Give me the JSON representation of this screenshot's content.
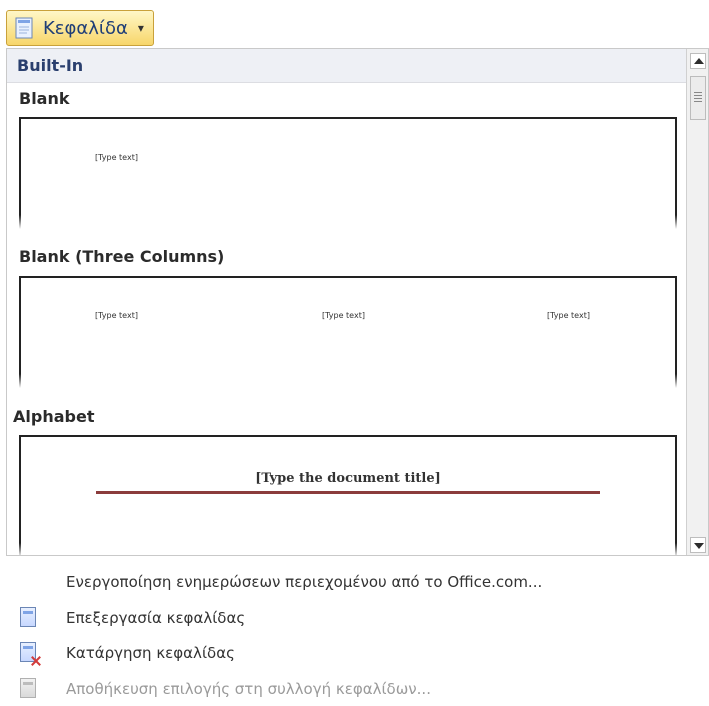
{
  "header": {
    "button_label": "Κεφαλίδα",
    "button_caret": "▾"
  },
  "gallery": {
    "builtin_label": "Built-In",
    "sections": {
      "blank": {
        "title": "Blank",
        "placeholder": "[Type text]"
      },
      "blank_three_columns": {
        "title": "Blank (Three Columns)",
        "placeholders": [
          "[Type text]",
          "[Type text]",
          "[Type text]"
        ]
      },
      "alphabet": {
        "title": "Alphabet",
        "document_title_placeholder": "[Type the document title]"
      }
    }
  },
  "menu": {
    "enable_updates": "Ενεργοποίηση ενημερώσεων περιεχομένου από το Office.com...",
    "edit_header": "Επεξεργασία κεφαλίδας",
    "remove_header": "Κατάργηση κεφαλίδας",
    "save_selection": "Αποθήκευση επιλογής στη συλλογή κεφαλίδων..."
  },
  "icons": {
    "header_button_icon": "document-header-icon",
    "edit_icon": "edit-header-icon",
    "remove_icon": "remove-header-icon",
    "save_icon": "save-header-icon"
  },
  "colors": {
    "ribbon_highlight": "#f7d66a",
    "title_text": "#1f3e77",
    "rule": "#8b3c3c",
    "remove_x": "#d23b3b"
  }
}
